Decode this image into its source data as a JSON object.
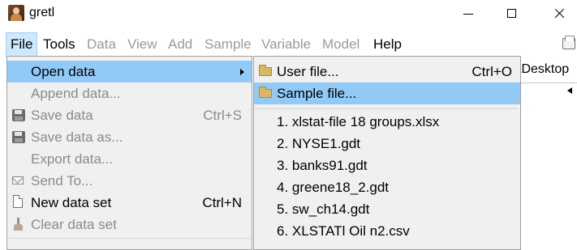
{
  "window": {
    "title": "gretl"
  },
  "menubar": {
    "items": [
      {
        "label": "File",
        "state": "active"
      },
      {
        "label": "Tools",
        "state": "enabled"
      },
      {
        "label": "Data",
        "state": "disabled"
      },
      {
        "label": "View",
        "state": "disabled"
      },
      {
        "label": "Add",
        "state": "disabled"
      },
      {
        "label": "Sample",
        "state": "disabled"
      },
      {
        "label": "Variable",
        "state": "disabled"
      },
      {
        "label": "Model",
        "state": "disabled"
      },
      {
        "label": "Help",
        "state": "enabled"
      }
    ]
  },
  "background": {
    "path_text": "\\Desktop"
  },
  "file_menu": {
    "items": [
      {
        "label": "Open data",
        "shortcut": "",
        "icon": "",
        "submenu": true,
        "enabled": true,
        "highlighted": true
      },
      {
        "label": "Append data...",
        "shortcut": "",
        "icon": "",
        "enabled": false
      },
      {
        "label": "Save data",
        "shortcut": "Ctrl+S",
        "icon": "floppy-icon",
        "enabled": false
      },
      {
        "label": "Save data as...",
        "shortcut": "",
        "icon": "floppy-icon",
        "enabled": false
      },
      {
        "label": "Export data...",
        "shortcut": "",
        "icon": "",
        "enabled": false
      },
      {
        "label": "Send To...",
        "shortcut": "",
        "icon": "envelope-icon",
        "enabled": false
      },
      {
        "label": "New data set",
        "shortcut": "Ctrl+N",
        "icon": "new-page-icon",
        "enabled": true
      },
      {
        "label": "Clear data set",
        "shortcut": "",
        "icon": "broom-icon",
        "enabled": false
      }
    ]
  },
  "open_data_submenu": {
    "items": [
      {
        "label": "User file...",
        "shortcut": "Ctrl+O",
        "icon": "folder-icon",
        "highlighted": false
      },
      {
        "label": "Sample file...",
        "shortcut": "",
        "icon": "folder-icon",
        "highlighted": true
      }
    ],
    "recent_files": [
      "1. xlstat-file 18 groups.xlsx",
      "2. NYSE1.gdt",
      "3. banks91.gdt",
      "4. greene18_2.gdt",
      "5. sw_ch14.gdt",
      "6. XLSTATl Oil n2.csv"
    ]
  },
  "colors": {
    "menu_background": "#f0f0f0",
    "menu_highlight": "#91c9f7",
    "menubar_active": "#cde8ff",
    "disabled_text": "#8b8b8b"
  }
}
